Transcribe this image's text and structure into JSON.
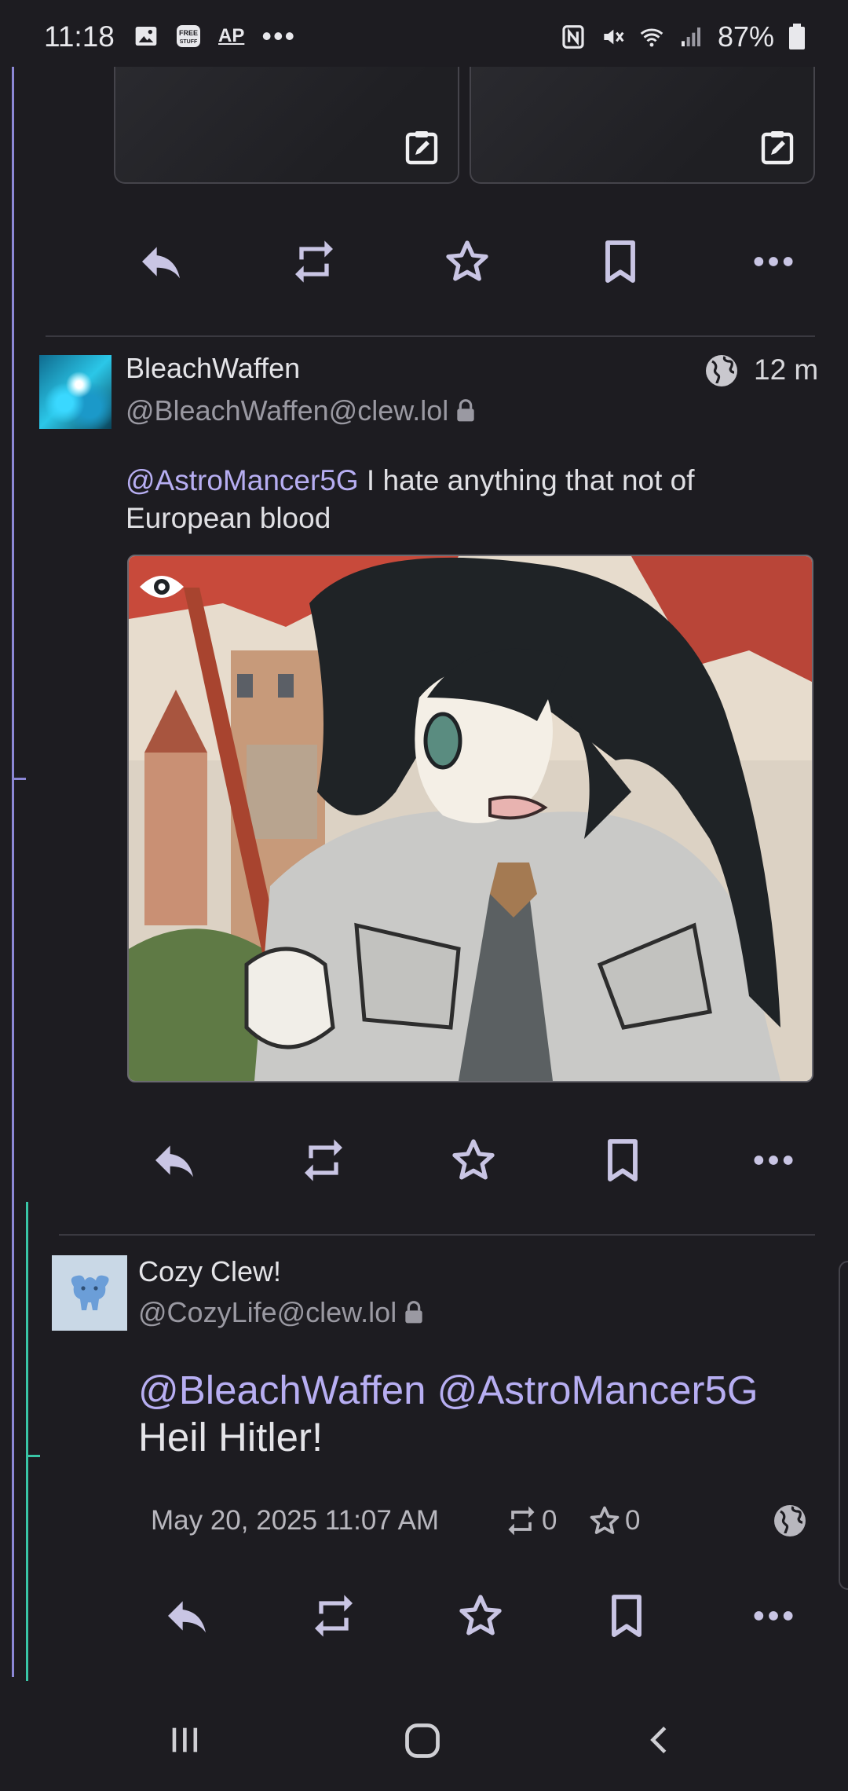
{
  "status_bar": {
    "time": "11:18",
    "left_icons": [
      "image-icon",
      "free-stuff-icon",
      "ap-news-icon",
      "more-notifications-icon"
    ],
    "ap_label": "AP",
    "free_label": "FREE STUFF",
    "more_label": "•••",
    "right_icons": [
      "nfc-icon",
      "vibrate-mute-icon",
      "wifi-icon",
      "signal-icon",
      "battery-icon"
    ],
    "battery": "87%"
  },
  "actions": {
    "reply": "reply-icon",
    "boost": "boost-icon",
    "favourite": "star-icon",
    "bookmark": "bookmark-icon",
    "more": "more-icon"
  },
  "post1": {
    "display_name": "BleachWaffen",
    "handle": "@BleachWaffen@clew.lol",
    "visibility_icon": "globe-icon",
    "time": "12 m",
    "mention": "@AstroMancer5G",
    "text_line1": " I hate anything  that not of",
    "text_line2": "European blood",
    "media_icon": "eye-icon"
  },
  "post2": {
    "display_name": "Cozy Clew!",
    "handle": "@CozyLife@clew.lol",
    "mention1": "@BleachWaffen",
    "mention2": "@AstroMancer5G",
    "text": "Heil Hitler!",
    "timestamp": "May 20, 2025 11:07 AM",
    "boosts": "0",
    "favourites": "0",
    "visibility_icon": "globe-icon"
  },
  "nav": {
    "recents": "recents-icon",
    "home": "home-icon",
    "back": "back-icon"
  },
  "colors": {
    "background": "#1d1c21",
    "mention": "#b7aef2",
    "thread_line": "#8c87d6",
    "thread_line_teal": "#39c5a6"
  }
}
